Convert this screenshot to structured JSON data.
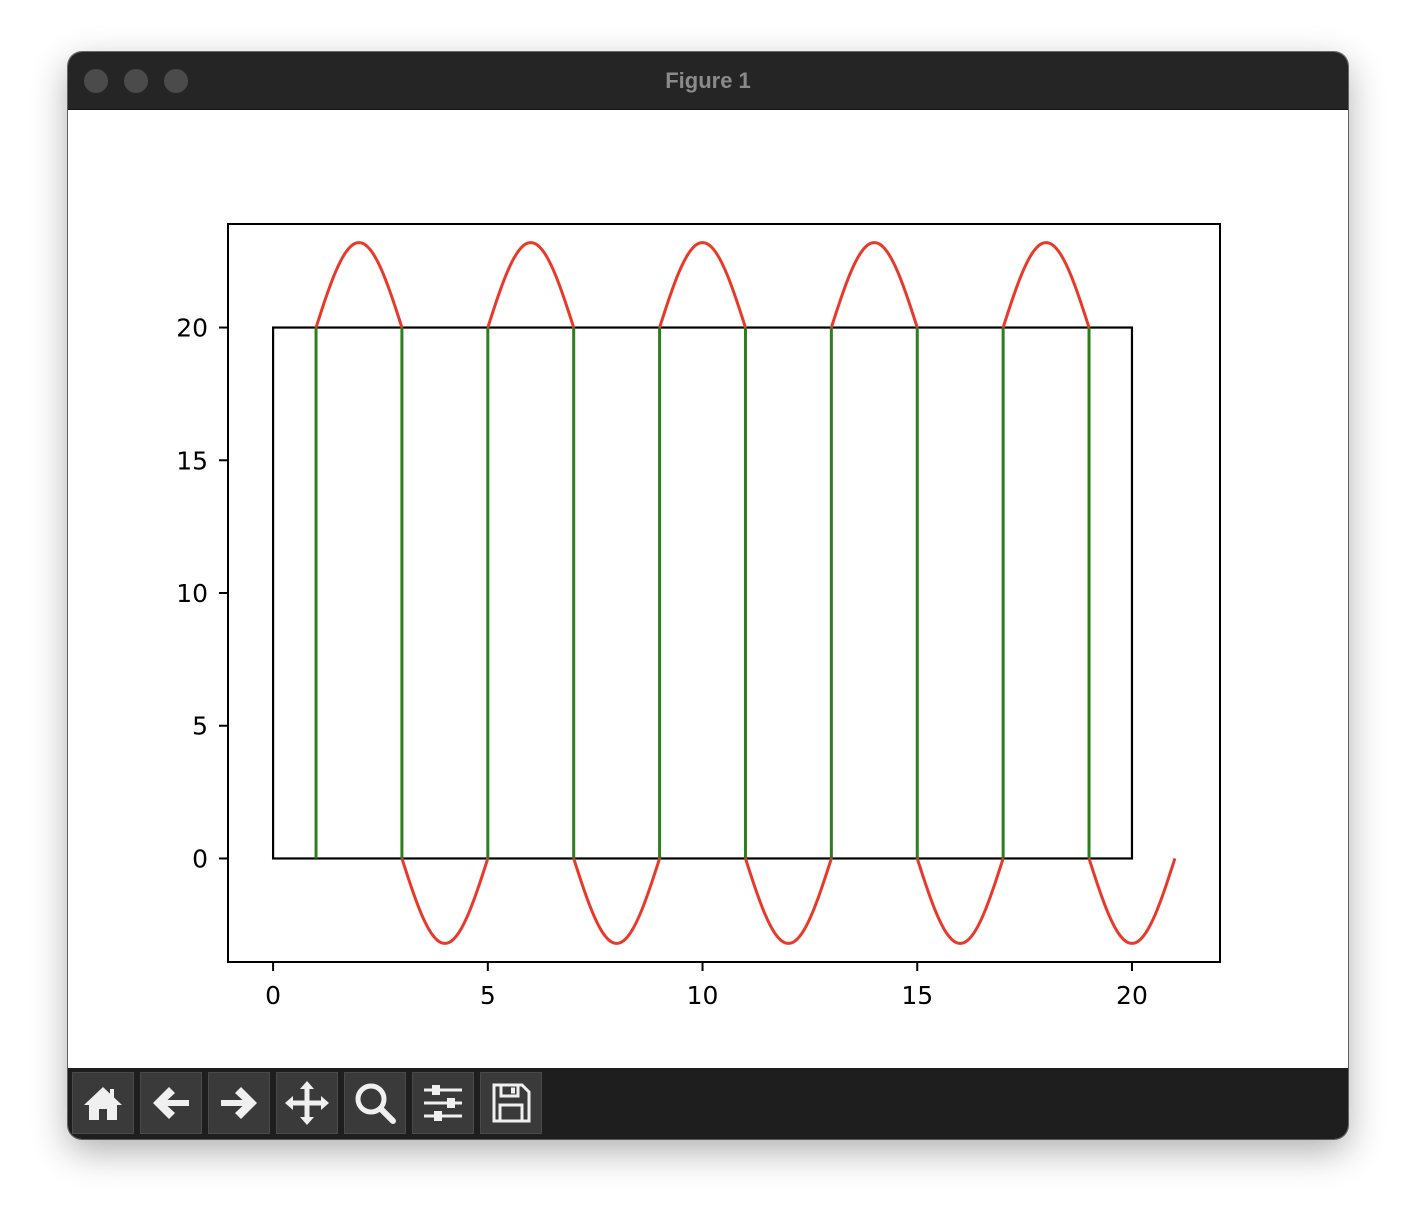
{
  "window": {
    "title": "Figure 1"
  },
  "toolbar": {
    "buttons": [
      {
        "name": "home-button",
        "icon": "home-icon"
      },
      {
        "name": "back-button",
        "icon": "arrow-left-icon"
      },
      {
        "name": "forward-button",
        "icon": "arrow-right-icon"
      },
      {
        "name": "pan-button",
        "icon": "move-icon"
      },
      {
        "name": "zoom-button",
        "icon": "magnifier-icon"
      },
      {
        "name": "subplots-button",
        "icon": "sliders-icon"
      },
      {
        "name": "save-button",
        "icon": "floppy-disk-icon"
      }
    ]
  },
  "colors": {
    "wave": "#e8392b",
    "verticals": "#2e7d1e",
    "frame": "#000000",
    "titlebar": "#252525",
    "toolbar": "#1e1e1e"
  },
  "chart_data": {
    "type": "line",
    "title": "",
    "xlabel": "",
    "ylabel": "",
    "xlim": [
      -1.05,
      22.05
    ],
    "ylim": [
      -3.9,
      23.9
    ],
    "xticks": [
      0,
      5,
      10,
      15,
      20
    ],
    "yticks": [
      0,
      5,
      10,
      15,
      20
    ],
    "grid": false,
    "legend": "none",
    "rectangle": {
      "x0": 0,
      "y0": 0,
      "x1": 20,
      "y1": 20
    },
    "vertical_lines": {
      "x": [
        1,
        3,
        5,
        7,
        9,
        11,
        13,
        15,
        17,
        19
      ],
      "y0": 0,
      "y1": 20
    },
    "wave": {
      "description_of_shape": "sine arcs outside the rectangle",
      "x_start": 1,
      "x_end": 21,
      "period": 4,
      "upper_baseline": 20,
      "upper_peak": 23.2,
      "lower_baseline": 0,
      "lower_trough": -3.2
    }
  }
}
